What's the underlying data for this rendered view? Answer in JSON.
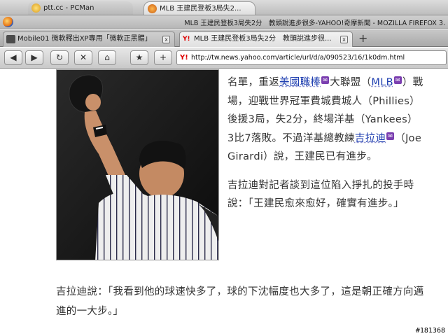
{
  "os_tabs": [
    {
      "label": "ptt.cc - PCMan"
    },
    {
      "label": "MLB 王建民登板3局失2..."
    }
  ],
  "window_title": "MLB 王建民登板3局失2分　教頭說進步很多-YAHOO!奇摩新聞 - MOZILLA FIREFOX 3.",
  "browser_tabs": [
    {
      "label": "Mobile01 微軟釋出XP專用「微軟正黑體」",
      "close": "x"
    },
    {
      "label": "MLB 王建民登板3局失2分　教頭說進步很...",
      "close": "x",
      "favicon": "Y!"
    }
  ],
  "new_tab_label": "+",
  "toolbar": {
    "back": "◀",
    "forward": "▶",
    "reload": "↻",
    "stop": "✕",
    "home": "⌂",
    "bookmark": "★",
    "add": "+"
  },
  "url": "http://tw.news.yahoo.com/article/url/d/a/090523/16/1k0dm.html",
  "url_favicon": "Y!",
  "article": {
    "p1": {
      "pre": "名單，重返",
      "link1": "美國職棒",
      "mid1": "大聯盟（",
      "link2": "MLB",
      "mid2": "）戰場，迎戰世界冠軍費城費城人（Phillies）後援3局，失2分，終場洋基（Yankees）3比7落敗。不過洋基總教練",
      "link3": "吉拉迪",
      "post": "（Joe Girardi）說，王建民已有進步。"
    },
    "p2": "吉拉迪對記者談到這位陷入掙扎的投手時說：「王建民愈來愈好，確實有進步。」",
    "p3": "吉拉迪說：「我看到他的球速快多了，球的下沈幅度也大多了，這是朝正確方向邁進的一大步。」"
  },
  "badge_glyph": "✉",
  "image_id": "#181368",
  "colors": {
    "link": "#1f3fb0",
    "badge": "#7b3fb0",
    "text": "#333333"
  }
}
